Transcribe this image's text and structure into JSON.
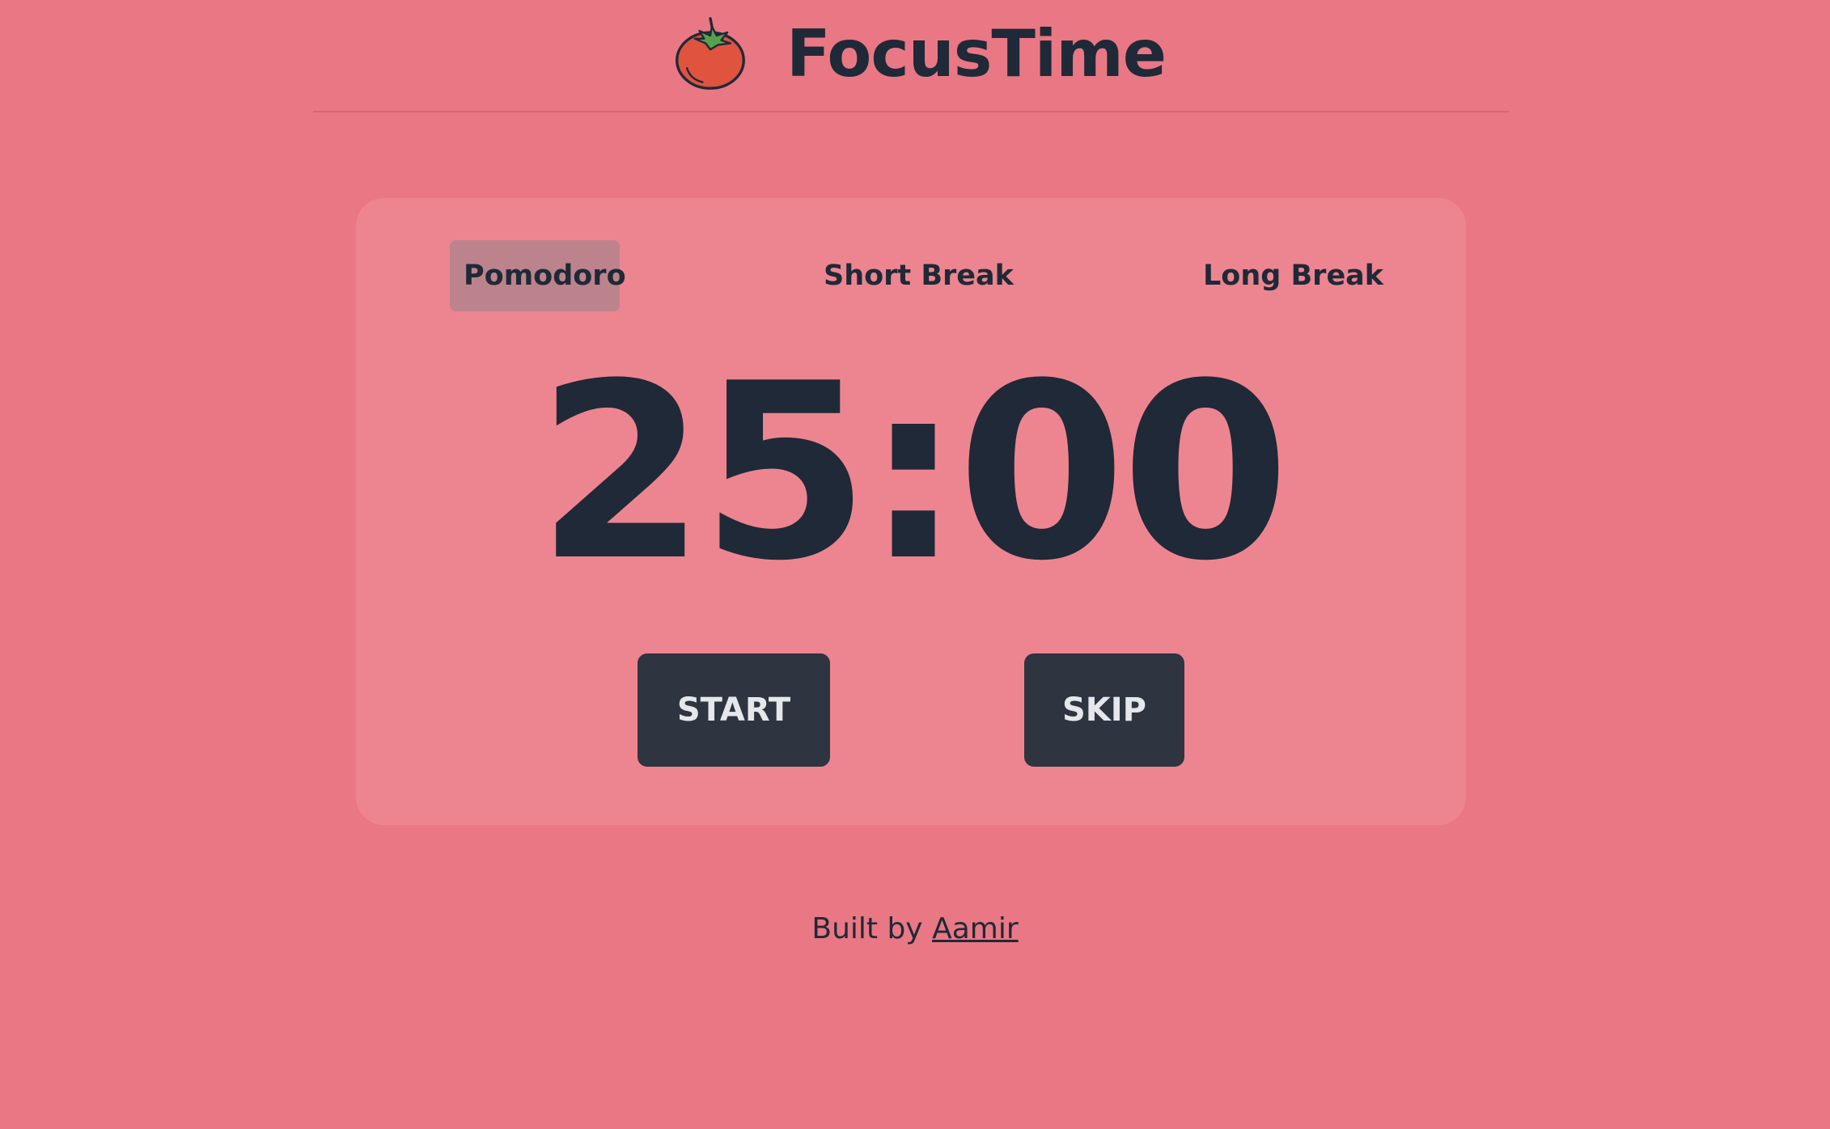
{
  "header": {
    "logo_icon": "tomato-icon",
    "title": "FocusTime"
  },
  "tabs": [
    {
      "label": "Pomodoro",
      "active": true
    },
    {
      "label": "Short Break",
      "active": false
    },
    {
      "label": "Long Break",
      "active": false
    }
  ],
  "timer": {
    "display": "25:00"
  },
  "controls": {
    "start_label": "START",
    "skip_label": "SKIP"
  },
  "footer": {
    "prefix": "Built by",
    "author_link": "Aamir"
  },
  "colors": {
    "background": "#e97884",
    "card": "#ed8590",
    "active_tab": "#bc838c",
    "button": "#2e3440",
    "text": "#1f2937"
  }
}
